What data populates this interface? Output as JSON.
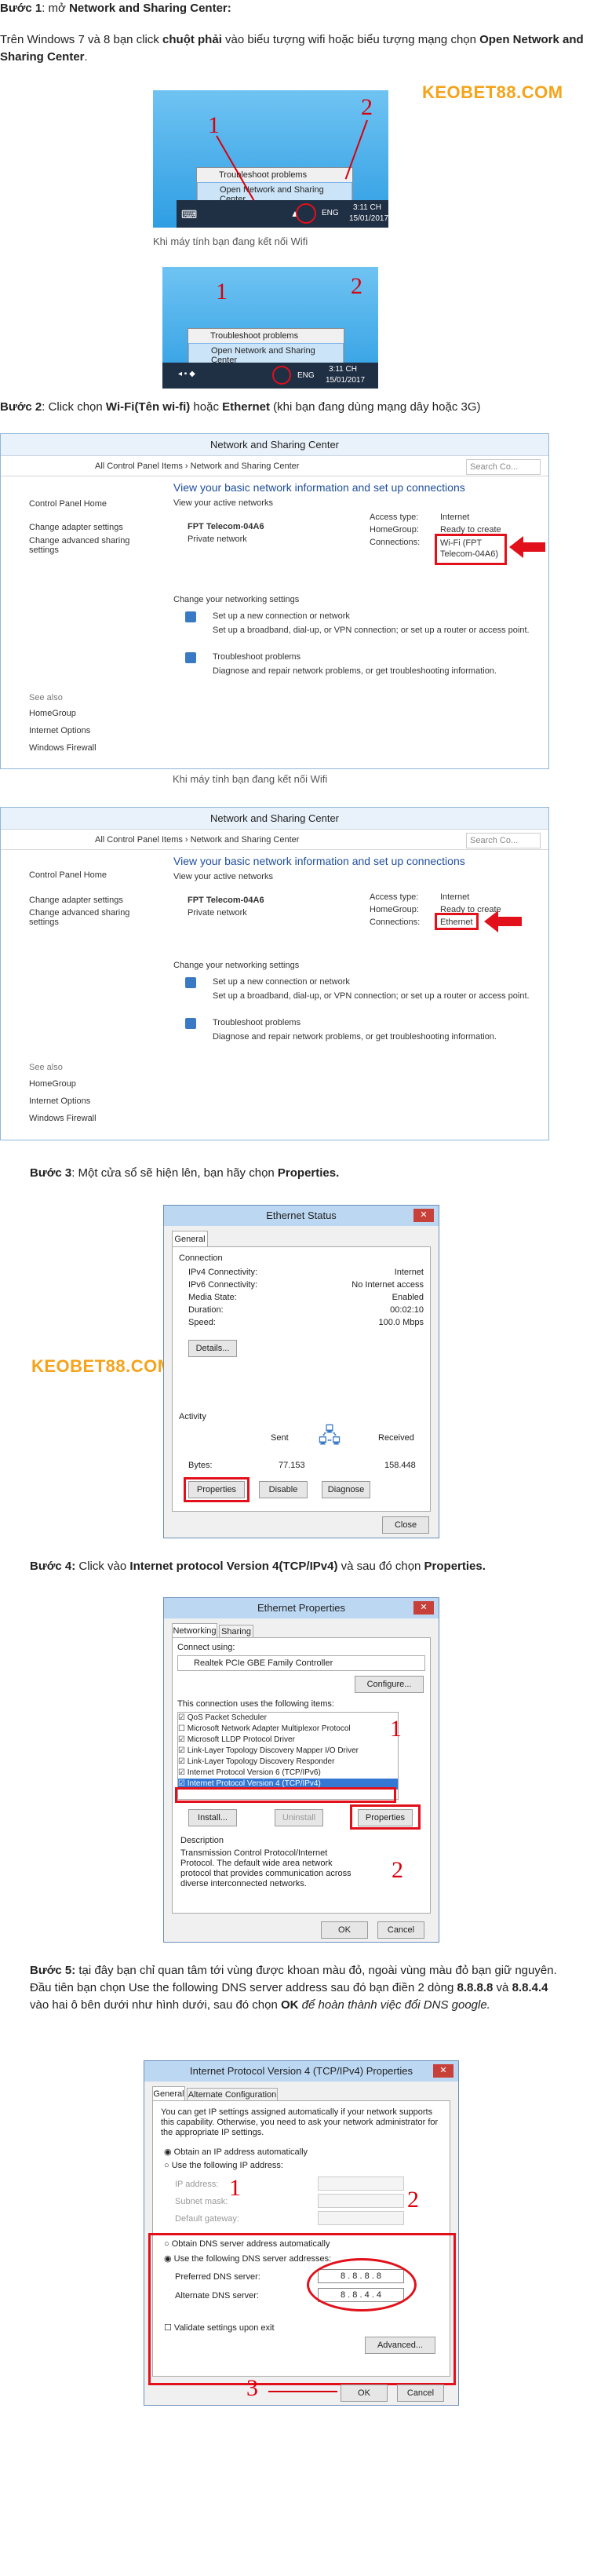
{
  "step1": {
    "title_bold": "Bước 1",
    "title_rest": ": mở ",
    "title_target": "Network and Sharing Center:",
    "body_pre": "Trên Windows 7 và 8 bạn click ",
    "body_bold1": "chuột phải",
    "body_mid": " vào biểu tượng wifi hoặc biểu tượng mạng chọn ",
    "body_bold2": "Open Network and Sharing Center",
    "body_end": ".",
    "menu_item1": "Troubleshoot problems",
    "menu_item2": "Open Network and Sharing Center",
    "tray_lang": "ENG",
    "tray_time": "3:11 CH",
    "tray_date": "15/01/2017",
    "caption": "Khi máy tính bạn đang kết nối Wifi",
    "num1": "1",
    "num2": "2"
  },
  "brand": "KEOBET88.COM",
  "step2": {
    "label_bold": "Bước 2",
    "label_pre": ": Click chọn ",
    "label_wifi": "Wi-Fi(Tên wi-fi)",
    "label_mid": " hoặc ",
    "label_eth": "Ethernet",
    "label_end": " (khi bạn đang dùng mạng dây hoặc 3G)",
    "window_title": "Network and Sharing Center",
    "breadcrumb": "All Control Panel Items  ›  Network and Sharing Center",
    "search_placeholder": "Search Co...",
    "side_links": [
      "Control Panel Home",
      "Change adapter settings",
      "Change advanced sharing settings"
    ],
    "see_also": "See also",
    "see_also_links": [
      "HomeGroup",
      "Internet Options",
      "Windows Firewall"
    ],
    "main_heading": "View your basic network information and set up connections",
    "active_networks": "View your active networks",
    "network_name": "FPT Telecom-04A6",
    "network_type": "Private network",
    "access_type_label": "Access type:",
    "access_type_value": "Internet",
    "homegroup_label": "HomeGroup:",
    "homegroup_value": "Ready to create",
    "connections_label": "Connections:",
    "connection_wifi": "Wi-Fi (FPT Telecom-04A6)",
    "connection_eth": "Ethernet",
    "change_settings": "Change your networking settings",
    "setup_link": "Set up a new connection or network",
    "setup_desc": "Set up a broadband, dial-up, or VPN connection; or set up a router or access point.",
    "troubleshoot_link": "Troubleshoot problems",
    "troubleshoot_desc": "Diagnose and repair network problems, or get troubleshooting information.",
    "caption": "Khi máy tính bạn đang kết nối Wifi"
  },
  "step3": {
    "label_bold": "Bước 3",
    "label_rest": ": Một cửa sổ sẽ hiện lên, bạn hãy chọn ",
    "label_target": "Properties.",
    "dlg_title": "Ethernet Status",
    "tab": "General",
    "connection": "Connection",
    "rows": [
      {
        "k": "IPv4 Connectivity:",
        "v": "Internet"
      },
      {
        "k": "IPv6 Connectivity:",
        "v": "No Internet access"
      },
      {
        "k": "Media State:",
        "v": "Enabled"
      },
      {
        "k": "Duration:",
        "v": "00:02:10"
      },
      {
        "k": "Speed:",
        "v": "100.0 Mbps"
      }
    ],
    "details_btn": "Details...",
    "activity": "Activity",
    "sent": "Sent",
    "received": "Received",
    "bytes": "Bytes:",
    "bytes_sent": "77.153",
    "bytes_recv": "158.448",
    "properties_btn": "Properties",
    "disable_btn": "Disable",
    "diagnose_btn": "Diagnose",
    "close_btn": "Close"
  },
  "step4": {
    "label_bold": "Bước 4:",
    "label_pre": " Click vào ",
    "label_target": "Internet protocol Version 4(TCP/IPv4)",
    "label_mid": " và sau đó chọn ",
    "label_end": "Properties.",
    "dlg_title": "Ethernet Properties",
    "tab1": "Networking",
    "tab2": "Sharing",
    "connect_using": "Connect using:",
    "adapter": "Realtek PCIe GBE Family Controller",
    "configure_btn": "Configure...",
    "items_label": "This connection uses the following items:",
    "items": [
      "QoS Packet Scheduler",
      "Microsoft Network Adapter Multiplexor Protocol",
      "Microsoft LLDP Protocol Driver",
      "Link-Layer Topology Discovery Mapper I/O Driver",
      "Link-Layer Topology Discovery Responder",
      "Internet Protocol Version 6 (TCP/IPv6)",
      "Internet Protocol Version 4 (TCP/IPv4)"
    ],
    "install_btn": "Install...",
    "uninstall_btn": "Uninstall",
    "properties_btn": "Properties",
    "description": "Description",
    "desc_text": "Transmission Control Protocol/Internet Protocol. The default wide area network protocol that provides communication across diverse interconnected networks.",
    "ok_btn": "OK",
    "cancel_btn": "Cancel",
    "num1": "1",
    "num2": "2"
  },
  "step5": {
    "label_bold": "Bước 5:",
    "label_pre": " tại đây bạn chỉ quan tâm tới vùng được khoan màu đỏ, ngoài vùng màu đỏ bạn giữ nguyên. Đầu tiên bạn chọn Use the following DNS server address sau đó bạn điền 2 dòng ",
    "dns1_bold": "8.8.8.8",
    "label_and": " và ",
    "dns2_bold": "8.8.4.4",
    "label_mid": " vào hai ô bên dưới như hình dưới, sau đó chọn ",
    "ok_bold": "OK",
    "label_italic": " để hoàn thành việc đổi DNS google.",
    "dlg_title": "Internet Protocol Version 4 (TCP/IPv4) Properties",
    "tab1": "General",
    "tab2": "Alternate Configuration",
    "intro": "You can get IP settings assigned automatically if your network supports this capability. Otherwise, you need to ask your network administrator for the appropriate IP settings.",
    "obtain_ip": "Obtain an IP address automatically",
    "use_ip": "Use the following IP address:",
    "ip_address": "IP address:",
    "subnet": "Subnet mask:",
    "gateway": "Default gateway:",
    "obtain_dns": "Obtain DNS server address automatically",
    "use_dns": "Use the following DNS server addresses:",
    "preferred": "Preferred DNS server:",
    "alternate": "Alternate DNS server:",
    "preferred_value": "8 . 8 . 8 . 8",
    "alternate_value": "8 . 8 . 4 . 4",
    "validate": "Validate settings upon exit",
    "advanced_btn": "Advanced...",
    "ok_btn": "OK",
    "cancel_btn": "Cancel",
    "num1": "1",
    "num2": "2",
    "num3": "3"
  }
}
